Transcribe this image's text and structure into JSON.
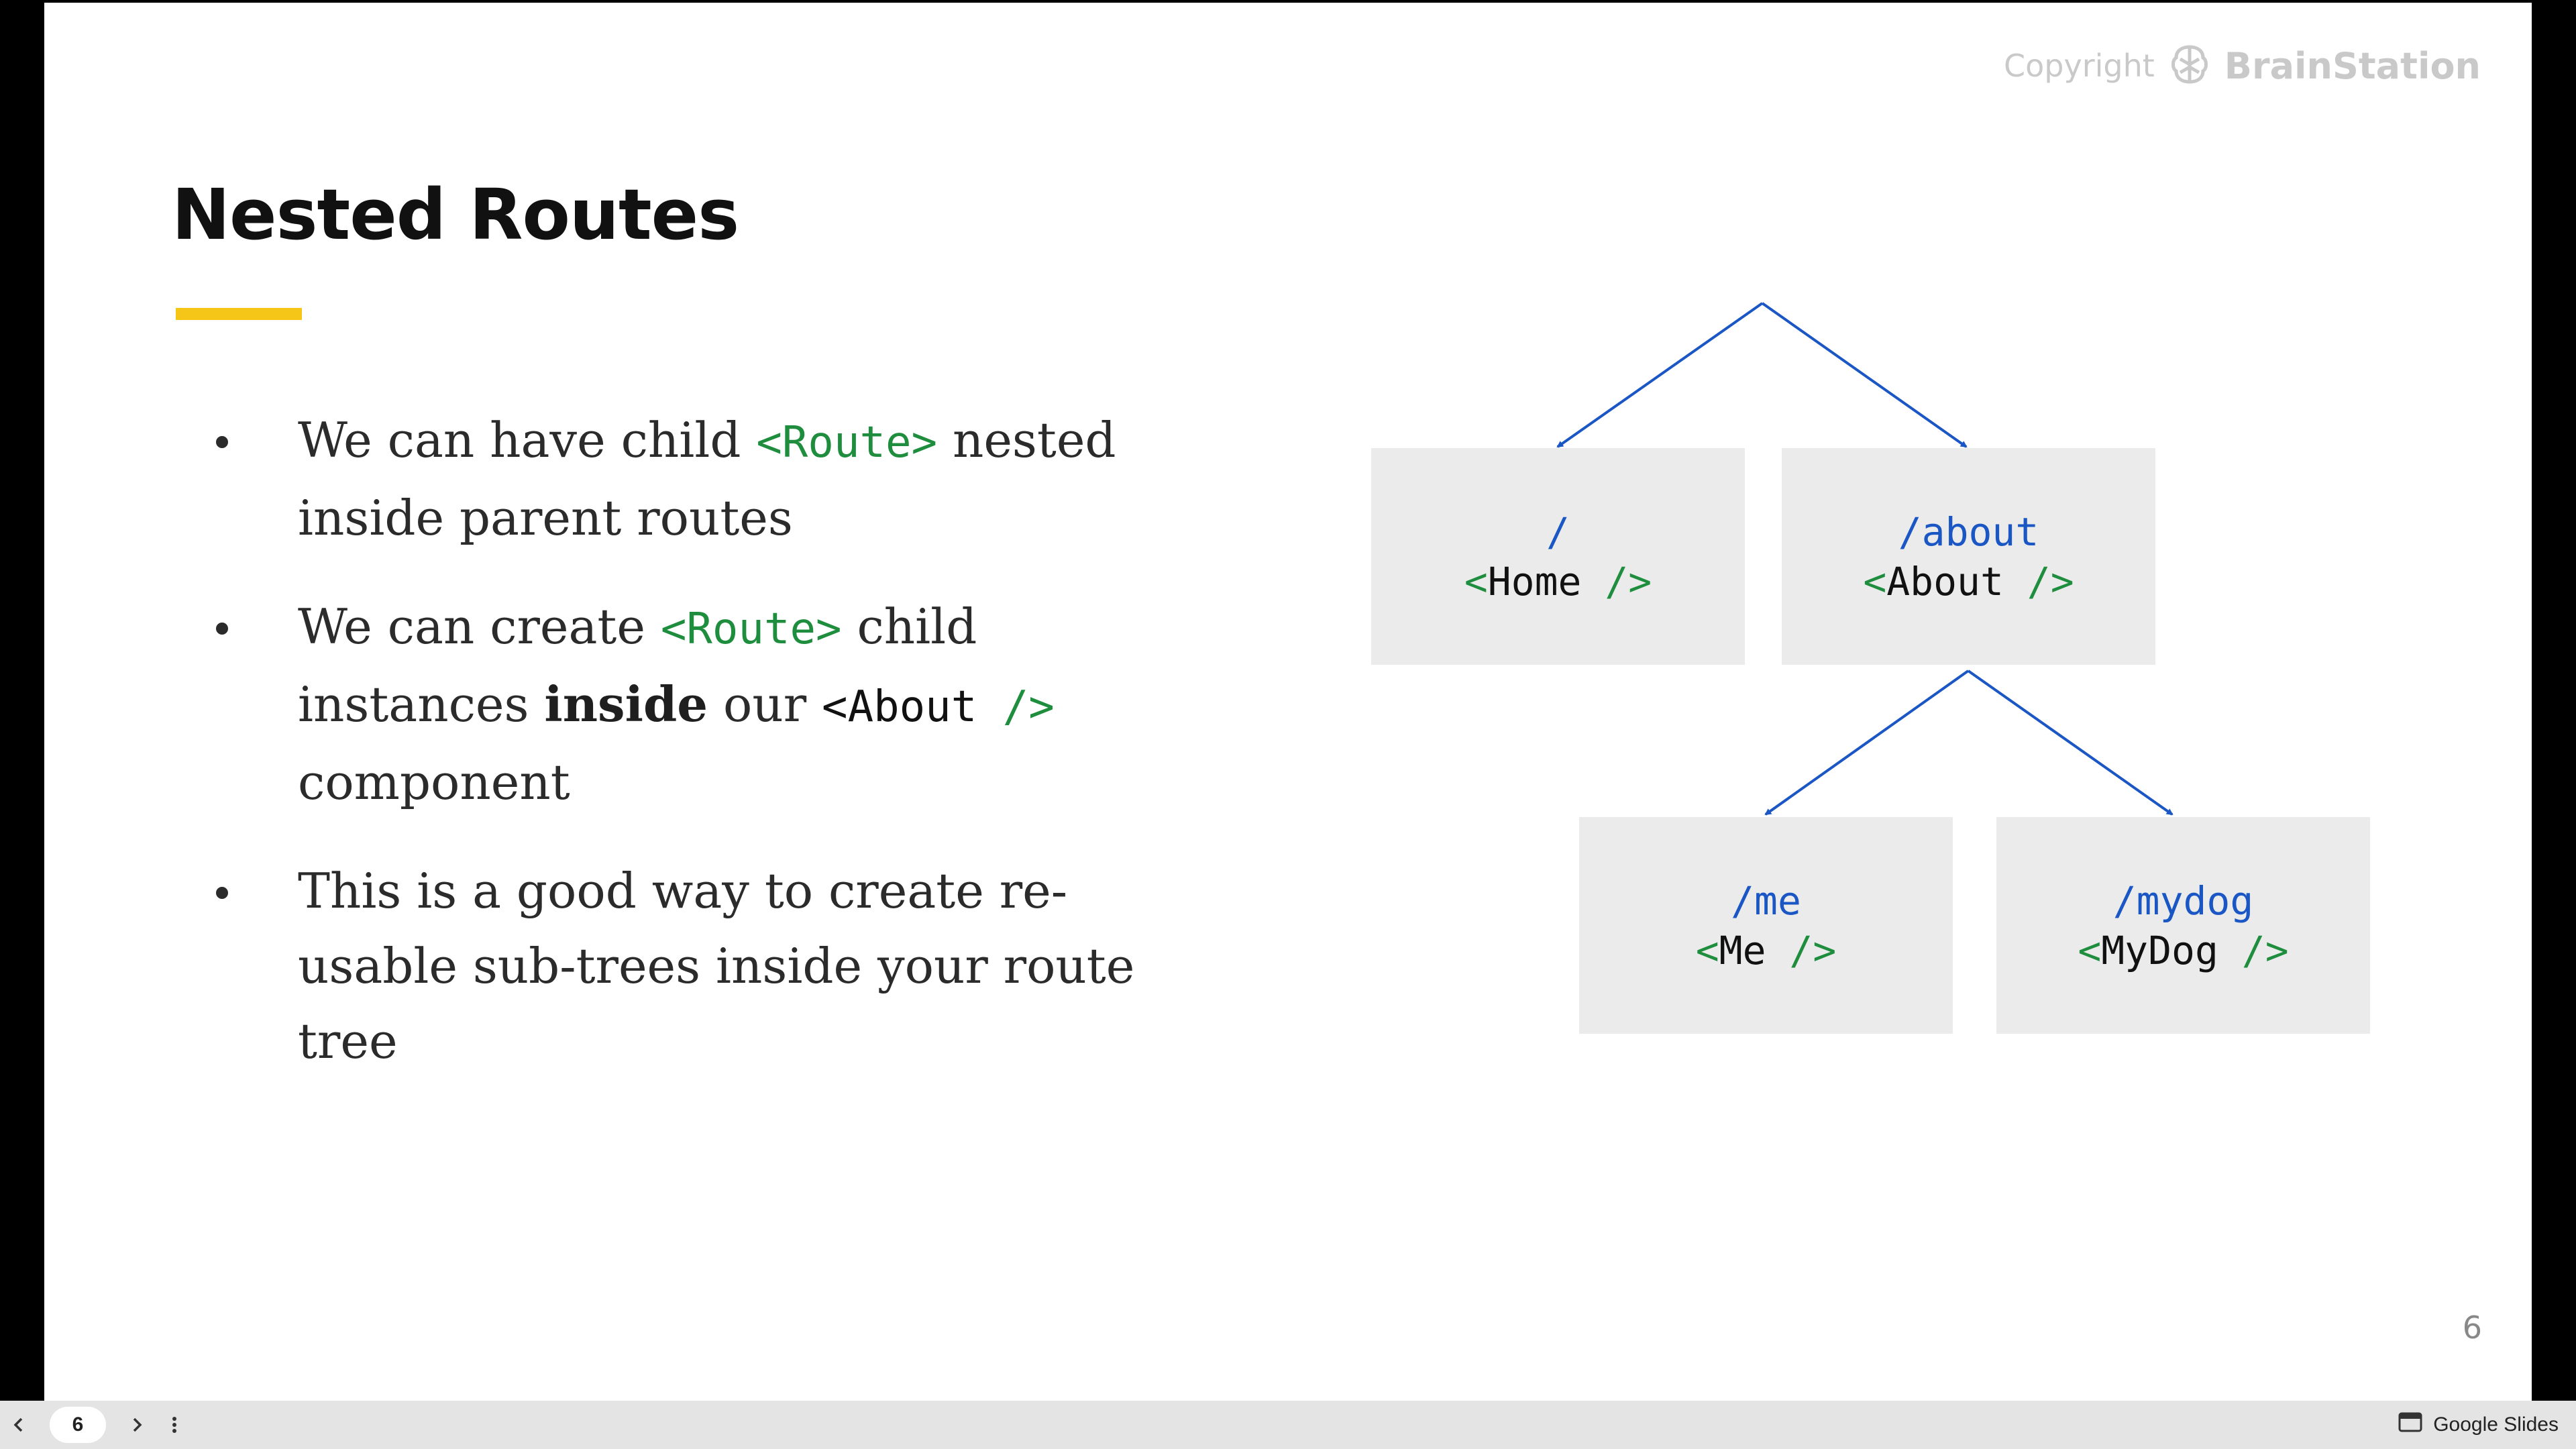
{
  "slide": {
    "copyright_label": "Copyright",
    "brand_name": "BrainStation",
    "title": "Nested Routes",
    "accent_color": "#f5c518",
    "bullets": [
      {
        "t1": "We can have child ",
        "c1": "<Route>",
        "t2": " nested inside parent routes"
      },
      {
        "t1": "We can create ",
        "c1": "<Route>",
        "t2": " child instances ",
        "bold": "inside",
        "t3": " our ",
        "c2a": "<About",
        "c2b": " />",
        "t4": " component"
      },
      {
        "t1": "This is a good way to create re-usable sub-trees inside your route tree"
      }
    ],
    "diagram": {
      "nodes": [
        {
          "path": "/",
          "lt": "<",
          "name": "Home",
          "close": " />"
        },
        {
          "path": "/about",
          "lt": "<",
          "name": "About",
          "close": " />"
        },
        {
          "path": "/me",
          "lt": "<",
          "name": "Me",
          "close": " />"
        },
        {
          "path": "/mydog",
          "lt": "<",
          "name": "MyDog",
          "close": " />"
        }
      ],
      "arrow_color": "#1a56c4",
      "box_color": "#ebebeb"
    },
    "page_number": "6"
  },
  "toolbar": {
    "prev_icon": "chevron-left-icon",
    "current_page": "6",
    "next_icon": "chevron-right-icon",
    "menu_icon": "more-vert-icon",
    "app_label": "Google Slides"
  }
}
